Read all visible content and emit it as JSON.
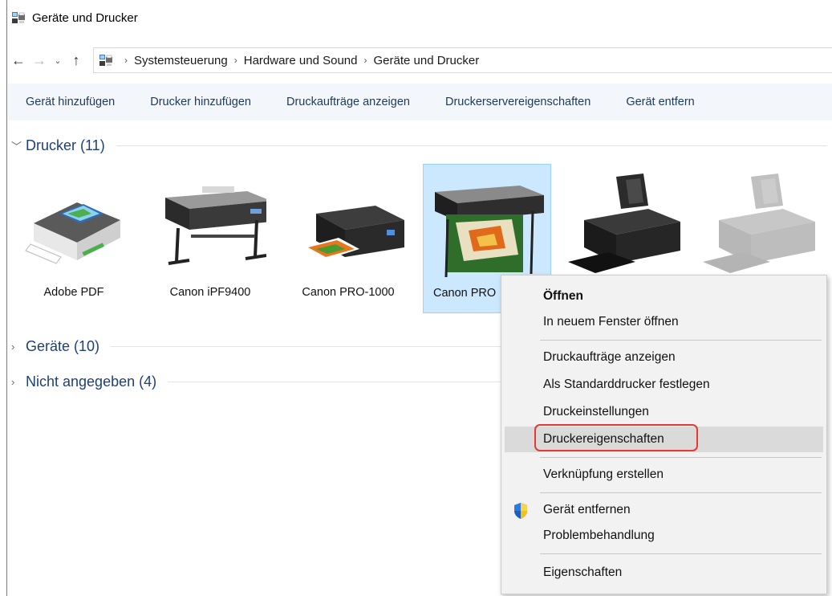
{
  "window": {
    "title": "Geräte und Drucker",
    "icon": "devices-printers-icon"
  },
  "address": {
    "back_icon": "back-arrow-icon",
    "forward_icon": "forward-arrow-icon",
    "recent_icon": "chevron-down-icon",
    "up_icon": "up-arrow-icon",
    "crumbs": [
      "Systemsteuerung",
      "Hardware und Sound",
      "Geräte und Drucker"
    ]
  },
  "commandbar": {
    "items": [
      "Gerät hinzufügen",
      "Drucker hinzufügen",
      "Druckaufträge anzeigen",
      "Druckerservereigenschaften",
      "Gerät entfern"
    ]
  },
  "groups": {
    "printers": {
      "label": "Drucker (11)",
      "expanded": true
    },
    "devices": {
      "label": "Geräte (10)",
      "expanded": false
    },
    "unspecified": {
      "label": "Nicht angegeben (4)",
      "expanded": false
    }
  },
  "printers": [
    {
      "label": "Adobe PDF",
      "icon": "virtual-printer-icon"
    },
    {
      "label": "Canon iPF9400",
      "icon": "large-format-printer-icon"
    },
    {
      "label": "Canon PRO-1000",
      "icon": "photo-printer-icon"
    },
    {
      "label": "Canon PRO",
      "icon": "large-format-photo-printer-icon",
      "selected": true
    },
    {
      "label": "",
      "icon": "inkjet-printer-icon"
    },
    {
      "label": "",
      "icon": "inkjet-printer-gray-icon"
    }
  ],
  "context_menu": {
    "open": "Öffnen",
    "open_new_window": "In neuem Fenster öffnen",
    "see_print_jobs": "Druckaufträge anzeigen",
    "set_default": "Als Standarddrucker festlegen",
    "printing_preferences": "Druckeinstellungen",
    "printer_properties": "Druckereigenschaften",
    "create_shortcut": "Verknüpfung erstellen",
    "remove_device": "Gerät entfernen",
    "troubleshoot": "Problembehandlung",
    "properties": "Eigenschaften",
    "shield_icon": "uac-shield-icon",
    "highlight_color": "#e53935"
  }
}
